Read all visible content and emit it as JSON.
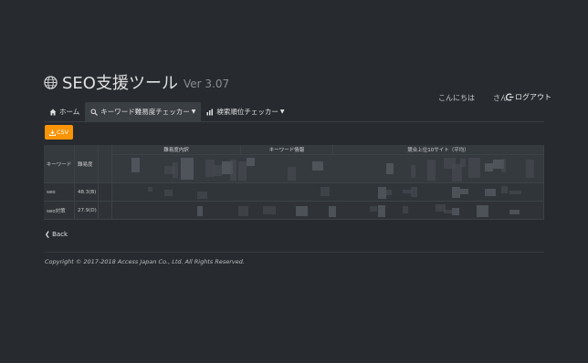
{
  "app": {
    "title": "SEO支援ツール",
    "version": "Ver 3.07"
  },
  "user": {
    "greeting": "こんにちは",
    "suffix": "さん",
    "logout_label": "ログアウト"
  },
  "tabs": [
    {
      "label": "ホーム",
      "icon": "home-icon"
    },
    {
      "label": "キーワード難易度チェッカー",
      "icon": "search-icon",
      "active": true,
      "dropdown": true
    },
    {
      "label": "検索順位チェッカー",
      "icon": "bar-chart-icon",
      "dropdown": true
    }
  ],
  "csv_button": {
    "label": "CSV",
    "icon": "download-icon"
  },
  "table": {
    "col_headers": {
      "keyword": "キーワード",
      "difficulty": "難易度"
    },
    "groups": [
      "難易度内訳",
      "キーワード情報",
      "競合上位10サイト（平均）"
    ],
    "rows": [
      {
        "keyword": "seo",
        "difficulty": "48.3(B)"
      },
      {
        "keyword": "seo対策",
        "difficulty": "27.9(D)"
      }
    ]
  },
  "back_link": {
    "label": "Back"
  },
  "footer": {
    "copyright": "Copyright © 2017-2018 Access Japan Co., Ltd. All Rights Reserved."
  },
  "colors": {
    "background": "#272b30",
    "accent": "#f89406",
    "table_bg": "#2f3337"
  }
}
